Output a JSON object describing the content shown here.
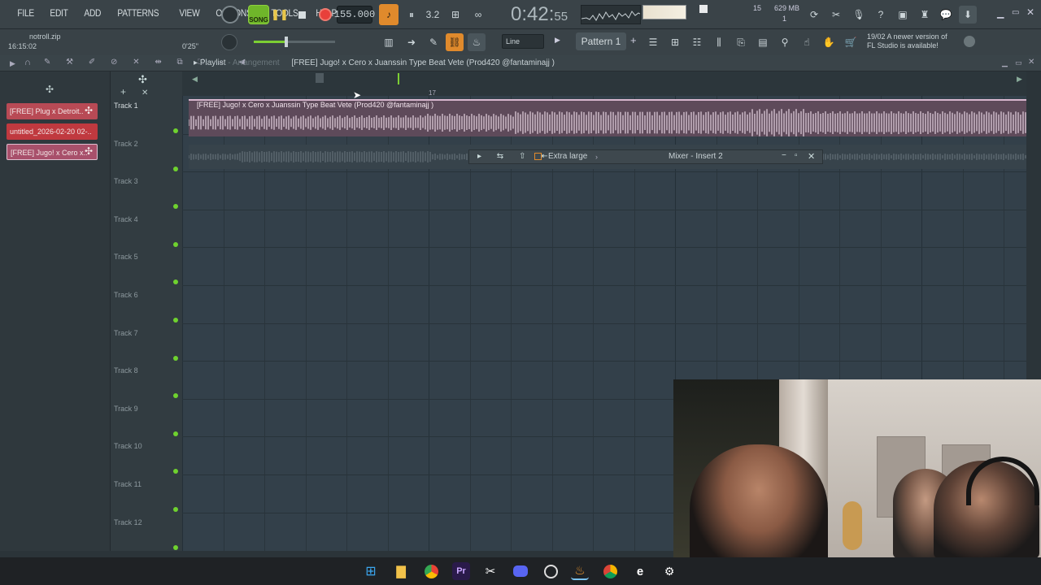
{
  "menu": [
    "FILE",
    "EDIT",
    "ADD",
    "PATTERNS",
    "VIEW",
    "OPTIONS",
    "TOOLS",
    "HELP"
  ],
  "transport": {
    "song_label": "SONG",
    "tempo": "155.000",
    "time_main": "0:42",
    "time_sub": "55",
    "cpu": "15",
    "mem": "629 MB",
    "voices": "1"
  },
  "file": {
    "name": "notroll.zip",
    "clock": "16:15:02",
    "duration": "0'25\""
  },
  "toolbar": {
    "snap": "Line",
    "pattern": "Pattern 1"
  },
  "update": {
    "date": "19/02",
    "text1": "A newer version of",
    "text2": "FL Studio is available!"
  },
  "playlist": {
    "label": "Playlist",
    "arrangement": "Arrangement",
    "title": "[FREE] Jugo! x Cero x Juanssin  Type Beat  Vete  (Prod420 @fantaminajj )",
    "ruler_mark": "17"
  },
  "picker": [
    {
      "label": "[FREE] Plug x Detroit..",
      "color": "#b84a55"
    },
    {
      "label": "untitled_2026-02-20 02-..",
      "color": "#c0393f"
    },
    {
      "label": "[FREE] Jugo! x Cero x..",
      "color": "#a8506b"
    }
  ],
  "tracks": [
    "Track 1",
    "Track 2",
    "Track 3",
    "Track 4",
    "Track 5",
    "Track 6",
    "Track 7",
    "Track 8",
    "Track 9",
    "Track 10",
    "Track 11",
    "Track 12"
  ],
  "clip1": {
    "title": "[FREE] Jugo! x Cero x Juanssin  Type Beat  Vete  (Prod420 @fantaminajj )"
  },
  "mixer": {
    "preset": "Extra large",
    "title": "Mixer - Insert 2"
  },
  "taskbar": [
    "windows-icon",
    "file-explorer-icon",
    "chrome-icon",
    "premiere-icon",
    "capcut-icon",
    "discord-icon",
    "app-icon",
    "fl-studio-icon",
    "chrome-canary-icon",
    "edge-icon",
    "settings-icon"
  ]
}
